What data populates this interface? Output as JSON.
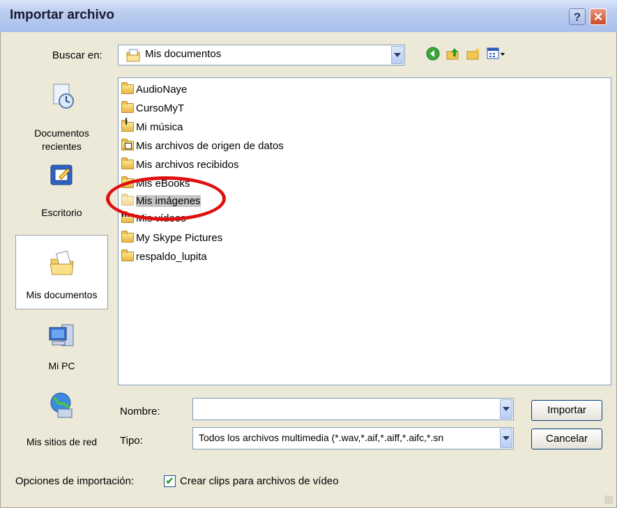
{
  "window": {
    "title": "Importar archivo",
    "help_label": "?",
    "close_label": "✕"
  },
  "lookin": {
    "label": "Buscar en:",
    "value": "Mis documentos"
  },
  "toolbar": {
    "icons": [
      "back-icon",
      "up-folder-icon",
      "new-folder-icon",
      "views-menu-icon"
    ]
  },
  "places": [
    {
      "label": "Documentos recientes",
      "icon": "recent-documents-icon"
    },
    {
      "label": "Escritorio",
      "icon": "desktop-icon"
    },
    {
      "label": "Mis documentos",
      "icon": "my-documents-icon"
    },
    {
      "label": "Mi PC",
      "icon": "my-computer-icon"
    },
    {
      "label": "Mis sitios de red",
      "icon": "network-places-icon"
    }
  ],
  "files": [
    {
      "name": "AudioNaye",
      "icon": "folder-icon"
    },
    {
      "name": "CursoMyT",
      "icon": "folder-icon"
    },
    {
      "name": "Mi música",
      "icon": "music-folder-icon"
    },
    {
      "name": "Mis archivos de origen de datos",
      "icon": "datasource-folder-icon"
    },
    {
      "name": "Mis archivos recibidos",
      "icon": "folder-icon"
    },
    {
      "name": "Mis eBooks",
      "icon": "folder-icon"
    },
    {
      "name": "Mis imágenes",
      "icon": "pictures-folder-icon",
      "highlighted": true
    },
    {
      "name": "Mis vídeos",
      "icon": "video-folder-icon"
    },
    {
      "name": "My Skype Pictures",
      "icon": "folder-icon"
    },
    {
      "name": "respaldo_lupita",
      "icon": "folder-icon"
    }
  ],
  "filename": {
    "label": "Nombre:",
    "value": ""
  },
  "filetype": {
    "label": "Tipo:",
    "value": "Todos los archivos multimedia (*.wav,*.aif,*.aiff,*.aifc,*.sn"
  },
  "buttons": {
    "import": "Importar",
    "cancel": "Cancelar"
  },
  "options": {
    "label": "Opciones de importación:",
    "checkbox_label": "Crear clips para archivos de vídeo",
    "checked": true,
    "check_mark": "✔"
  },
  "annotation": {
    "color": "#e01010"
  }
}
